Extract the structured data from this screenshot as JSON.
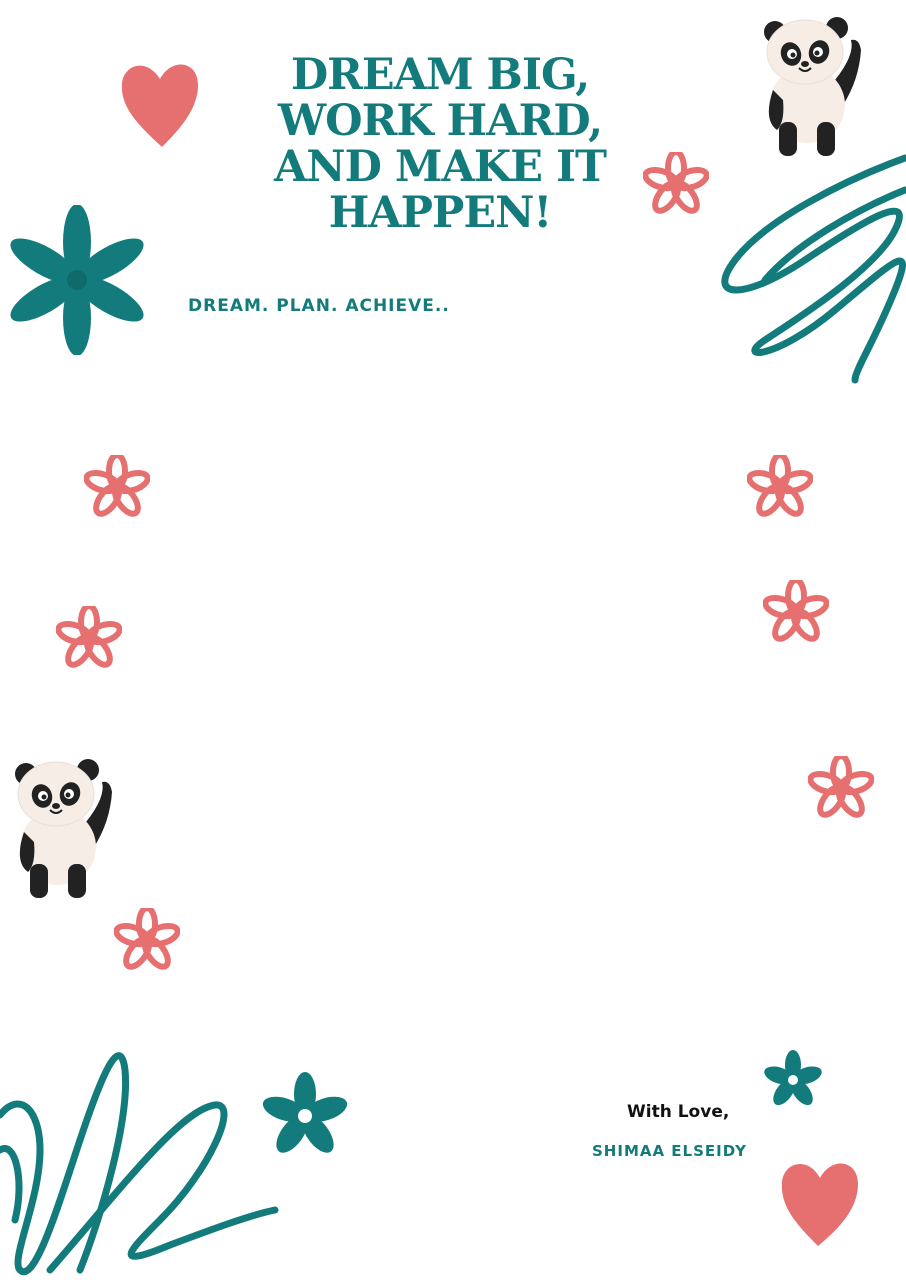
{
  "header": {
    "title_lines": [
      "Dream big,",
      "work hard,",
      "and make it",
      "happen!"
    ],
    "tagline": "Dream. Plan. Achieve.."
  },
  "footer": {
    "signoff": "With Love,",
    "signature": "Shimaa Elseidy"
  },
  "colors": {
    "teal": "#137b7b",
    "coral": "#e66f6f",
    "panda_black": "#222222",
    "panda_white": "#f6ede6"
  },
  "decorations": [
    "heart-icon",
    "flower-icon",
    "panda-icon",
    "scribble"
  ]
}
